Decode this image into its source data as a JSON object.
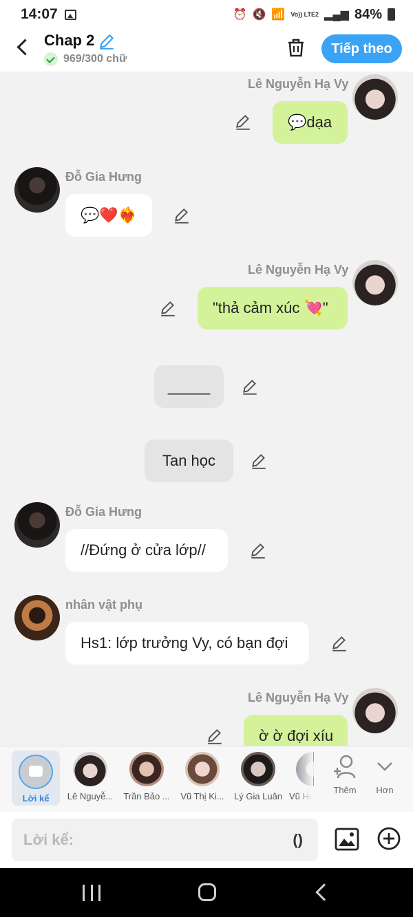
{
  "status_bar": {
    "time": "14:07",
    "network_label": "Vo)) LTE2",
    "battery": "84%"
  },
  "header": {
    "title": "Chap 2",
    "word_count": "969/300 chữ",
    "next_label": "Tiếp theo"
  },
  "messages": [
    {
      "kind": "me",
      "name": "Lê Nguyễn Hạ Vy",
      "text": "💬dạa"
    },
    {
      "kind": "other",
      "name": "Đỗ Gia Hưng",
      "text": "💬❤️❤️‍🔥"
    },
    {
      "kind": "me",
      "name": "Lê Nguyễn Hạ Vy",
      "text": "\"thả cảm xúc 💘\""
    },
    {
      "kind": "narration",
      "text": "_____"
    },
    {
      "kind": "narration",
      "text": "Tan học"
    },
    {
      "kind": "other",
      "name": "Đỗ Gia Hưng",
      "text": "//Đứng ở cửa lớp//"
    },
    {
      "kind": "other",
      "name": "nhân vật phụ",
      "text": "Hs1: lớp trưởng Vy, có bạn đợi"
    },
    {
      "kind": "me",
      "name": "Lê Nguyễn Hạ Vy",
      "text": "ờ ờ đợi xíu"
    }
  ],
  "characters": {
    "narrator_label": "Lời kể",
    "items": [
      "Lê Nguyễ...",
      "Trần Bảo ...",
      "Vũ Thị Ki...",
      "Lý Gia Luân",
      "Vũ Hc"
    ],
    "add_label": "Thêm",
    "more_label": "Hơn"
  },
  "input": {
    "placeholder": "Lời kể:",
    "paren_label": "()"
  },
  "colors": {
    "accent": "#3aa3f5",
    "my_bubble": "#d3f29a",
    "other_bubble": "#ffffff",
    "narration_bubble": "#e4e4e4"
  }
}
